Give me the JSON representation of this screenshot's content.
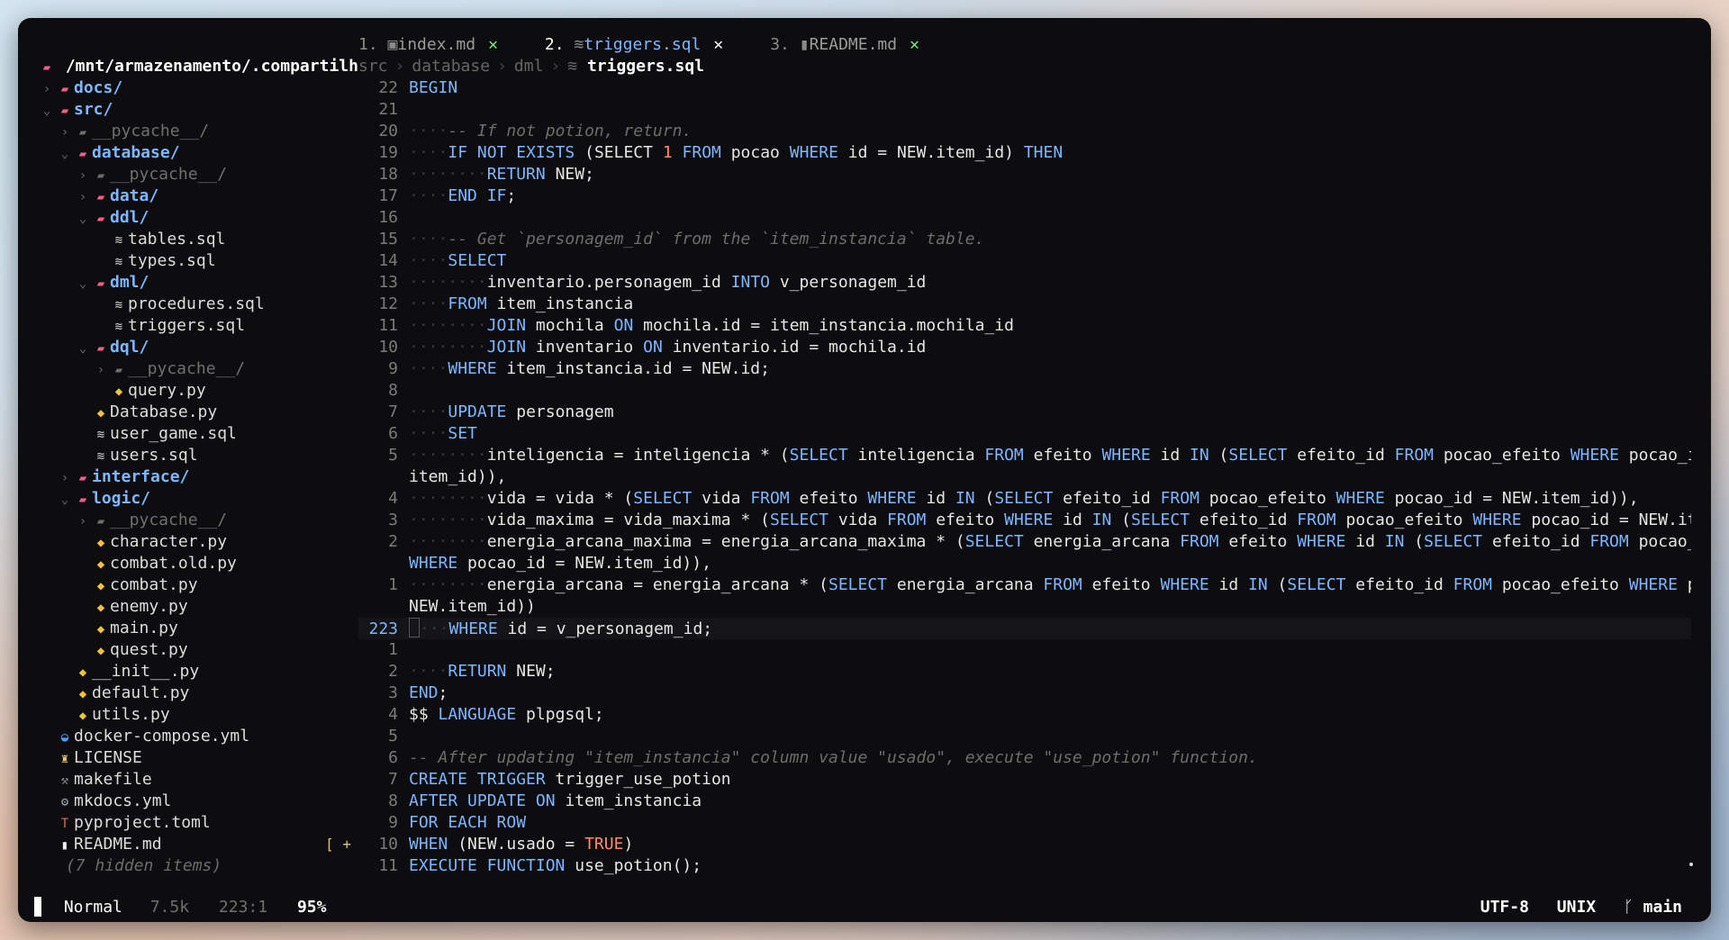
{
  "tabs": [
    {
      "num": "1.",
      "icon": "markdown-icon",
      "title": "index.md",
      "close": "✕",
      "active": false
    },
    {
      "num": "2.",
      "icon": "database-icon",
      "title": "triggers.sql",
      "close": "✕",
      "active": true
    },
    {
      "num": "3.",
      "icon": "document-icon",
      "title": "README.md",
      "close": "✕",
      "active": false
    }
  ],
  "breadcrumb": {
    "parts": [
      "src",
      "database",
      "dml"
    ],
    "current": "triggers.sql"
  },
  "sidebar": {
    "root": "/mnt/armazenamento/.compartilh",
    "items": [
      {
        "depth": 0,
        "kind": "folder",
        "chev": "closed",
        "name": "docs/"
      },
      {
        "depth": 0,
        "kind": "folder-open",
        "chev": "open",
        "name": "src/"
      },
      {
        "depth": 1,
        "kind": "folder-dim",
        "chev": "closed",
        "name": "__pycache__/"
      },
      {
        "depth": 1,
        "kind": "folder-open",
        "chev": "open",
        "name": "database/"
      },
      {
        "depth": 2,
        "kind": "folder-dim",
        "chev": "closed",
        "name": "__pycache__/"
      },
      {
        "depth": 2,
        "kind": "folder",
        "chev": "closed",
        "name": "data/"
      },
      {
        "depth": 2,
        "kind": "folder-open",
        "chev": "open",
        "name": "ddl/"
      },
      {
        "depth": 3,
        "kind": "db",
        "chev": "",
        "name": "tables.sql"
      },
      {
        "depth": 3,
        "kind": "db",
        "chev": "",
        "name": "types.sql"
      },
      {
        "depth": 2,
        "kind": "folder-open",
        "chev": "open",
        "name": "dml/"
      },
      {
        "depth": 3,
        "kind": "db",
        "chev": "",
        "name": "procedures.sql"
      },
      {
        "depth": 3,
        "kind": "db",
        "chev": "",
        "name": "triggers.sql"
      },
      {
        "depth": 2,
        "kind": "folder-open",
        "chev": "open",
        "name": "dql/"
      },
      {
        "depth": 3,
        "kind": "folder-dim",
        "chev": "closed",
        "name": "__pycache__/"
      },
      {
        "depth": 3,
        "kind": "py",
        "chev": "",
        "name": "query.py"
      },
      {
        "depth": 2,
        "kind": "py",
        "chev": "",
        "name": "Database.py"
      },
      {
        "depth": 2,
        "kind": "db",
        "chev": "",
        "name": "user_game.sql"
      },
      {
        "depth": 2,
        "kind": "db",
        "chev": "",
        "name": "users.sql"
      },
      {
        "depth": 1,
        "kind": "folder",
        "chev": "closed",
        "name": "interface/"
      },
      {
        "depth": 1,
        "kind": "folder-open",
        "chev": "open",
        "name": "logic/"
      },
      {
        "depth": 2,
        "kind": "folder-dim",
        "chev": "closed",
        "name": "__pycache__/"
      },
      {
        "depth": 2,
        "kind": "py",
        "chev": "",
        "name": "character.py"
      },
      {
        "depth": 2,
        "kind": "py",
        "chev": "",
        "name": "combat.old.py"
      },
      {
        "depth": 2,
        "kind": "py",
        "chev": "",
        "name": "combat.py"
      },
      {
        "depth": 2,
        "kind": "py",
        "chev": "",
        "name": "enemy.py"
      },
      {
        "depth": 2,
        "kind": "py",
        "chev": "",
        "name": "main.py"
      },
      {
        "depth": 2,
        "kind": "py",
        "chev": "",
        "name": "quest.py"
      },
      {
        "depth": 1,
        "kind": "py",
        "chev": "",
        "name": "__init__.py"
      },
      {
        "depth": 1,
        "kind": "py",
        "chev": "",
        "name": "default.py"
      },
      {
        "depth": 1,
        "kind": "py",
        "chev": "",
        "name": "utils.py"
      },
      {
        "depth": 0,
        "kind": "docker",
        "chev": "",
        "name": "docker-compose.yml"
      },
      {
        "depth": 0,
        "kind": "license",
        "chev": "",
        "name": "LICENSE"
      },
      {
        "depth": 0,
        "kind": "make",
        "chev": "",
        "name": "makefile"
      },
      {
        "depth": 0,
        "kind": "gear",
        "chev": "",
        "name": "mkdocs.yml"
      },
      {
        "depth": 0,
        "kind": "toml",
        "chev": "",
        "name": "pyproject.toml"
      },
      {
        "depth": 0,
        "kind": "readme",
        "chev": "",
        "name": "README.md",
        "git": "[ +"
      }
    ],
    "hidden": "(7 hidden items)"
  },
  "code": [
    {
      "ln": "22",
      "t": [
        [
          "kw",
          "BEGIN"
        ]
      ]
    },
    {
      "ln": "21",
      "t": []
    },
    {
      "ln": "20",
      "t": [
        [
          "indent",
          "····"
        ],
        [
          "cmt",
          "-- If not potion, return."
        ]
      ]
    },
    {
      "ln": "19",
      "t": [
        [
          "indent",
          "····"
        ],
        [
          "kw",
          "IF"
        ],
        [
          "id",
          " "
        ],
        [
          "kw",
          "NOT"
        ],
        [
          "id",
          " "
        ],
        [
          "kw",
          "EXISTS"
        ],
        [
          "id",
          " (SELECT "
        ],
        [
          "num",
          "1"
        ],
        [
          "id",
          " "
        ],
        [
          "kw",
          "FROM"
        ],
        [
          "id",
          " pocao "
        ],
        [
          "kw",
          "WHERE"
        ],
        [
          "id",
          " id = NEW.item_id) "
        ],
        [
          "kw",
          "THEN"
        ]
      ]
    },
    {
      "ln": "18",
      "t": [
        [
          "indent",
          "········"
        ],
        [
          "kw",
          "RETURN"
        ],
        [
          "id",
          " NEW;"
        ]
      ]
    },
    {
      "ln": "17",
      "t": [
        [
          "indent",
          "····"
        ],
        [
          "kw",
          "END IF"
        ],
        [
          "id",
          ";"
        ]
      ]
    },
    {
      "ln": "16",
      "t": []
    },
    {
      "ln": "15",
      "t": [
        [
          "indent",
          "····"
        ],
        [
          "cmt",
          "-- Get `personagem_id` from the `item_instancia` table."
        ]
      ]
    },
    {
      "ln": "14",
      "t": [
        [
          "indent",
          "····"
        ],
        [
          "kw",
          "SELECT"
        ]
      ]
    },
    {
      "ln": "13",
      "t": [
        [
          "indent",
          "········"
        ],
        [
          "id",
          "inventario.personagem_id "
        ],
        [
          "kw",
          "INTO"
        ],
        [
          "id",
          " v_personagem_id"
        ]
      ]
    },
    {
      "ln": "12",
      "t": [
        [
          "indent",
          "····"
        ],
        [
          "kw",
          "FROM"
        ],
        [
          "id",
          " item_instancia"
        ]
      ]
    },
    {
      "ln": "11",
      "t": [
        [
          "indent",
          "········"
        ],
        [
          "kw",
          "JOIN"
        ],
        [
          "id",
          " mochila "
        ],
        [
          "kw",
          "ON"
        ],
        [
          "id",
          " mochila.id = item_instancia.mochila_id"
        ]
      ]
    },
    {
      "ln": "10",
      "t": [
        [
          "indent",
          "········"
        ],
        [
          "kw",
          "JOIN"
        ],
        [
          "id",
          " inventario "
        ],
        [
          "kw",
          "ON"
        ],
        [
          "id",
          " inventario.id = mochila.id"
        ]
      ]
    },
    {
      "ln": "9",
      "t": [
        [
          "indent",
          "····"
        ],
        [
          "kw",
          "WHERE"
        ],
        [
          "id",
          " item_instancia.id = NEW.id;"
        ]
      ]
    },
    {
      "ln": "8",
      "t": []
    },
    {
      "ln": "7",
      "t": [
        [
          "indent",
          "····"
        ],
        [
          "kw",
          "UPDATE"
        ],
        [
          "id",
          " personagem"
        ]
      ]
    },
    {
      "ln": "6",
      "t": [
        [
          "indent",
          "····"
        ],
        [
          "kw",
          "SET"
        ]
      ]
    },
    {
      "ln": "5",
      "t": [
        [
          "indent",
          "········"
        ],
        [
          "id",
          "inteligencia = inteligencia * ("
        ],
        [
          "kw",
          "SELECT"
        ],
        [
          "id",
          " inteligencia "
        ],
        [
          "kw",
          "FROM"
        ],
        [
          "id",
          " efeito "
        ],
        [
          "kw",
          "WHERE"
        ],
        [
          "id",
          " id "
        ],
        [
          "kw",
          "IN"
        ],
        [
          "id",
          " ("
        ],
        [
          "kw",
          "SELECT"
        ],
        [
          "id",
          " efeito_id "
        ],
        [
          "kw",
          "FROM"
        ],
        [
          "id",
          " pocao_efeito "
        ],
        [
          "kw",
          "WHERE"
        ],
        [
          "id",
          " pocao_id = NEW."
        ]
      ]
    },
    {
      "ln": "",
      "t": [
        [
          "id",
          "item_id)),"
        ]
      ]
    },
    {
      "ln": "4",
      "t": [
        [
          "indent",
          "········"
        ],
        [
          "id",
          "vida = vida * ("
        ],
        [
          "kw",
          "SELECT"
        ],
        [
          "id",
          " vida "
        ],
        [
          "kw",
          "FROM"
        ],
        [
          "id",
          " efeito "
        ],
        [
          "kw",
          "WHERE"
        ],
        [
          "id",
          " id "
        ],
        [
          "kw",
          "IN"
        ],
        [
          "id",
          " ("
        ],
        [
          "kw",
          "SELECT"
        ],
        [
          "id",
          " efeito_id "
        ],
        [
          "kw",
          "FROM"
        ],
        [
          "id",
          " pocao_efeito "
        ],
        [
          "kw",
          "WHERE"
        ],
        [
          "id",
          " pocao_id = NEW.item_id)),"
        ]
      ]
    },
    {
      "ln": "3",
      "t": [
        [
          "indent",
          "········"
        ],
        [
          "id",
          "vida_maxima = vida_maxima * ("
        ],
        [
          "kw",
          "SELECT"
        ],
        [
          "id",
          " vida "
        ],
        [
          "kw",
          "FROM"
        ],
        [
          "id",
          " efeito "
        ],
        [
          "kw",
          "WHERE"
        ],
        [
          "id",
          " id "
        ],
        [
          "kw",
          "IN"
        ],
        [
          "id",
          " ("
        ],
        [
          "kw",
          "SELECT"
        ],
        [
          "id",
          " efeito_id "
        ],
        [
          "kw",
          "FROM"
        ],
        [
          "id",
          " pocao_efeito "
        ],
        [
          "kw",
          "WHERE"
        ],
        [
          "id",
          " pocao_id = NEW.item_id)),"
        ]
      ]
    },
    {
      "ln": "2",
      "t": [
        [
          "indent",
          "········"
        ],
        [
          "id",
          "energia_arcana_maxima = energia_arcana_maxima * ("
        ],
        [
          "kw",
          "SELECT"
        ],
        [
          "id",
          " energia_arcana "
        ],
        [
          "kw",
          "FROM"
        ],
        [
          "id",
          " efeito "
        ],
        [
          "kw",
          "WHERE"
        ],
        [
          "id",
          " id "
        ],
        [
          "kw",
          "IN"
        ],
        [
          "id",
          " ("
        ],
        [
          "kw",
          "SELECT"
        ],
        [
          "id",
          " efeito_id "
        ],
        [
          "kw",
          "FROM"
        ],
        [
          "id",
          " pocao_efeito"
        ]
      ]
    },
    {
      "ln": "",
      "t": [
        [
          "kw",
          "WHERE"
        ],
        [
          "id",
          " pocao_id = NEW.item_id)),"
        ]
      ]
    },
    {
      "ln": "1",
      "t": [
        [
          "indent",
          "········"
        ],
        [
          "id",
          "energia_arcana = energia_arcana * ("
        ],
        [
          "kw",
          "SELECT"
        ],
        [
          "id",
          " energia_arcana "
        ],
        [
          "kw",
          "FROM"
        ],
        [
          "id",
          " efeito "
        ],
        [
          "kw",
          "WHERE"
        ],
        [
          "id",
          " id "
        ],
        [
          "kw",
          "IN"
        ],
        [
          "id",
          " ("
        ],
        [
          "kw",
          "SELECT"
        ],
        [
          "id",
          " efeito_id "
        ],
        [
          "kw",
          "FROM"
        ],
        [
          "id",
          " pocao_efeito "
        ],
        [
          "kw",
          "WHERE"
        ],
        [
          "id",
          " pocao_id ="
        ]
      ]
    },
    {
      "ln": "",
      "t": [
        [
          "id",
          "NEW.item_id))"
        ]
      ]
    },
    {
      "ln": "223",
      "current": true,
      "t": [
        [
          "cursor",
          ""
        ],
        [
          "indent",
          "···"
        ],
        [
          "kw",
          "WHERE"
        ],
        [
          "id",
          " id = v_personagem_id;"
        ]
      ]
    },
    {
      "ln": "1",
      "t": []
    },
    {
      "ln": "2",
      "t": [
        [
          "indent",
          "····"
        ],
        [
          "kw",
          "RETURN"
        ],
        [
          "id",
          " NEW;"
        ]
      ]
    },
    {
      "ln": "3",
      "t": [
        [
          "kw",
          "END"
        ],
        [
          "id",
          ";"
        ]
      ]
    },
    {
      "ln": "4",
      "t": [
        [
          "id",
          "$$ "
        ],
        [
          "kw",
          "LANGUAGE"
        ],
        [
          "id",
          " plpgsql;"
        ]
      ]
    },
    {
      "ln": "5",
      "t": []
    },
    {
      "ln": "6",
      "t": [
        [
          "cmt",
          "-- After updating \"item_instancia\" column value \"usado\", execute \"use_potion\" function."
        ]
      ]
    },
    {
      "ln": "7",
      "t": [
        [
          "kw",
          "CREATE TRIGGER"
        ],
        [
          "id",
          " trigger_use_potion"
        ]
      ]
    },
    {
      "ln": "8",
      "t": [
        [
          "kw",
          "AFTER UPDATE ON"
        ],
        [
          "id",
          " item_instancia"
        ]
      ]
    },
    {
      "ln": "9",
      "t": [
        [
          "kw",
          "FOR EACH ROW"
        ]
      ]
    },
    {
      "ln": "10",
      "t": [
        [
          "kw",
          "WHEN"
        ],
        [
          "id",
          " (NEW.usado = "
        ],
        [
          "bool",
          "TRUE"
        ],
        [
          "id",
          ")"
        ]
      ]
    },
    {
      "ln": "11",
      "t": [
        [
          "kw",
          "EXECUTE FUNCTION"
        ],
        [
          "id",
          " use_potion();"
        ]
      ]
    }
  ],
  "status": {
    "mode": "Normal",
    "size": "7.5k",
    "position": "223:1",
    "percent": "95%",
    "encoding": "UTF-8",
    "format": "UNIX",
    "branch": "main"
  }
}
